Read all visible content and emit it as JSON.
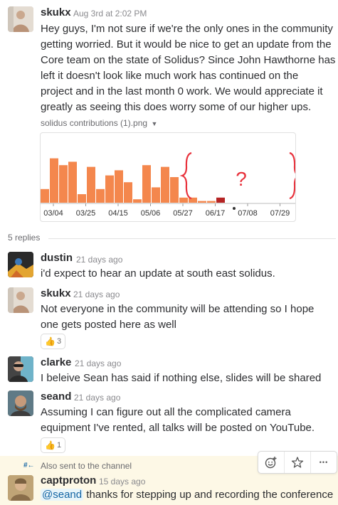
{
  "colors": {
    "bar": "#f4874d",
    "bar_last": "#b52424",
    "bracket": "#e8323c",
    "highlight_bg": "#fdf8e6",
    "mention": "#1264a3"
  },
  "main_message": {
    "author": "skukx",
    "time": "Aug 3rd at 2:02 PM",
    "lines": [
      "Hey guys, I'm not sure if we're the only ones in the community",
      "getting worried. But it would be nice to get an update from the",
      "Core team on the state of Solidus?  Since John Hawthorne has",
      "left it doesn't look like much work has continued on the",
      "project and in the last month 0 work.  We would appreciate it",
      "greatly as seeing this does worry some of our higher ups."
    ],
    "attachment_name": "solidus contributions (1).png",
    "attachment_caret": "▼"
  },
  "chart_data": {
    "type": "bar",
    "title": "",
    "xlabel": "",
    "ylabel": "",
    "x_ticks": [
      "03/04",
      "03/25",
      "04/15",
      "05/06",
      "05/27",
      "06/17",
      "07/08",
      "07/29"
    ],
    "values": [
      8,
      26,
      22,
      24,
      5,
      21,
      8,
      16,
      19,
      12,
      2,
      22,
      9,
      21,
      15,
      3,
      3,
      1,
      1,
      3
    ],
    "ylim": [
      0,
      30
    ],
    "annotation": "?",
    "grid": false
  },
  "thread": {
    "replies_label": "5 replies",
    "replies": [
      {
        "author": "dustin",
        "time": "21 days ago",
        "text": "i'd expect to hear an update at south east solidus."
      },
      {
        "author": "skukx",
        "time": "21 days ago",
        "lines": [
          "Not everyone in the community will be attending so I hope",
          "one gets posted here as well"
        ],
        "reaction": {
          "emoji": "👍",
          "count": "3"
        }
      },
      {
        "author": "clarke",
        "time": "21 days ago",
        "text": "I beleive Sean has said if nothing else, slides will be shared"
      },
      {
        "author": "seand",
        "time": "21 days ago",
        "lines": [
          "Assuming I can figure out all the complicated camera",
          "equipment I've rented, all talks will be posted on YouTube."
        ],
        "reaction": {
          "emoji": "👍",
          "count": "1"
        }
      },
      {
        "author": "captproton",
        "time": "15 days ago",
        "channel_note": "Also sent to the channel",
        "channel_icon": "#←",
        "mention": "@seand",
        "text": " thanks for stepping up and recording the conference"
      }
    ]
  },
  "toolbar": {
    "icons": [
      "add-reaction-icon",
      "star-icon",
      "more-icon"
    ],
    "more_label": "•••"
  }
}
